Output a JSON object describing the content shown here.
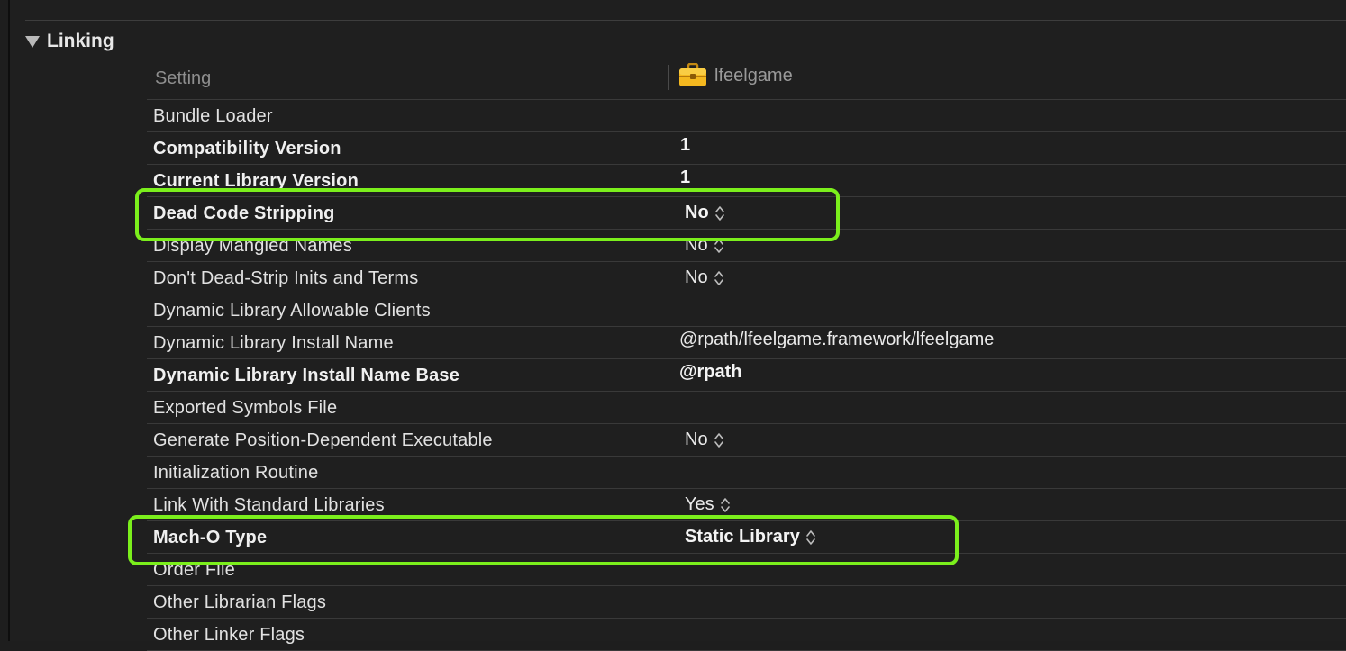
{
  "section": {
    "title": "Linking"
  },
  "header": {
    "setting": "Setting",
    "target": "lfeelgame",
    "target_icon": "toolbox-icon"
  },
  "rows": [
    {
      "name": "Bundle Loader",
      "value": "",
      "bold": false,
      "popup": false
    },
    {
      "name": "Compatibility Version",
      "value": "1",
      "bold": true,
      "popup": false
    },
    {
      "name": "Current Library Version",
      "value": "1",
      "bold": true,
      "popup": false
    },
    {
      "name": "Dead Code Stripping",
      "value": "No",
      "bold": true,
      "popup": true
    },
    {
      "name": "Display Mangled Names",
      "value": "No",
      "bold": false,
      "popup": true
    },
    {
      "name": "Don't Dead-Strip Inits and Terms",
      "value": "No",
      "bold": false,
      "popup": true
    },
    {
      "name": "Dynamic Library Allowable Clients",
      "value": "",
      "bold": false,
      "popup": false
    },
    {
      "name": "Dynamic Library Install Name",
      "value": "@rpath/lfeelgame.framework/lfeelgame",
      "bold": false,
      "popup": false
    },
    {
      "name": "Dynamic Library Install Name Base",
      "value": "@rpath",
      "bold": true,
      "popup": false
    },
    {
      "name": "Exported Symbols File",
      "value": "",
      "bold": false,
      "popup": false
    },
    {
      "name": "Generate Position-Dependent Executable",
      "value": "No",
      "bold": false,
      "popup": true
    },
    {
      "name": "Initialization Routine",
      "value": "",
      "bold": false,
      "popup": false
    },
    {
      "name": "Link With Standard Libraries",
      "value": "Yes",
      "bold": false,
      "popup": true
    },
    {
      "name": "Mach-O Type",
      "value": "Static Library",
      "bold": true,
      "popup": true
    },
    {
      "name": "Order File",
      "value": "",
      "bold": false,
      "popup": false
    },
    {
      "name": "Other Librarian Flags",
      "value": "",
      "bold": false,
      "popup": false
    },
    {
      "name": "Other Linker Flags",
      "value": "",
      "bold": false,
      "popup": false
    }
  ],
  "highlight_color": "#7bef1c"
}
